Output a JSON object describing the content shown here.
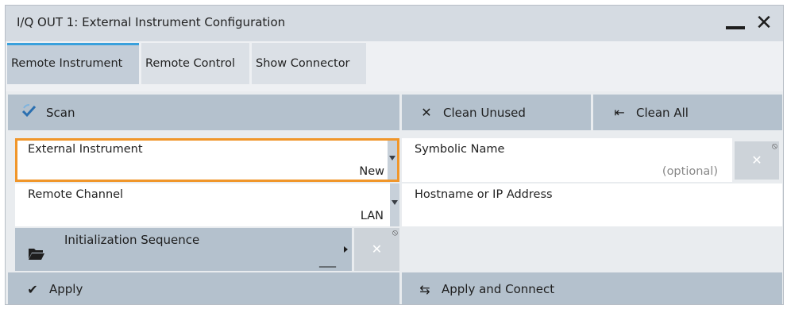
{
  "window": {
    "title": "I/Q OUT 1: External Instrument Configuration"
  },
  "tabs": [
    {
      "label": "Remote Instrument",
      "active": true
    },
    {
      "label": "Remote Control",
      "active": false
    },
    {
      "label": "Show Connector",
      "active": false
    }
  ],
  "buttons": {
    "scan": "Scan",
    "clean_unused": "Clean Unused",
    "clean_all": "Clean All",
    "apply": "Apply",
    "apply_connect": "Apply and Connect"
  },
  "fields": {
    "external_instrument": {
      "label": "External Instrument",
      "value": "New"
    },
    "symbolic_name": {
      "label": "Symbolic Name",
      "placeholder": "(optional)"
    },
    "remote_channel": {
      "label": "Remote Channel",
      "value": "LAN"
    },
    "hostname": {
      "label": "Hostname or IP Address",
      "value": ""
    },
    "init_sequence": {
      "label": "Initialization Sequence",
      "value": "___"
    }
  },
  "colors": {
    "accent_tab": "#39a0dc",
    "focus_border": "#f0962a",
    "button_bg": "#b4c1cd"
  },
  "icons": {
    "scan": "checkmark-spin-icon",
    "clean_unused": "x-icon",
    "clean_all": "arrow-to-left-bar-icon",
    "apply": "checkmark-icon",
    "apply_connect": "swap-arrows-icon",
    "folder": "folder-open-icon",
    "close": "close-icon",
    "minimize": "minimize-icon"
  }
}
